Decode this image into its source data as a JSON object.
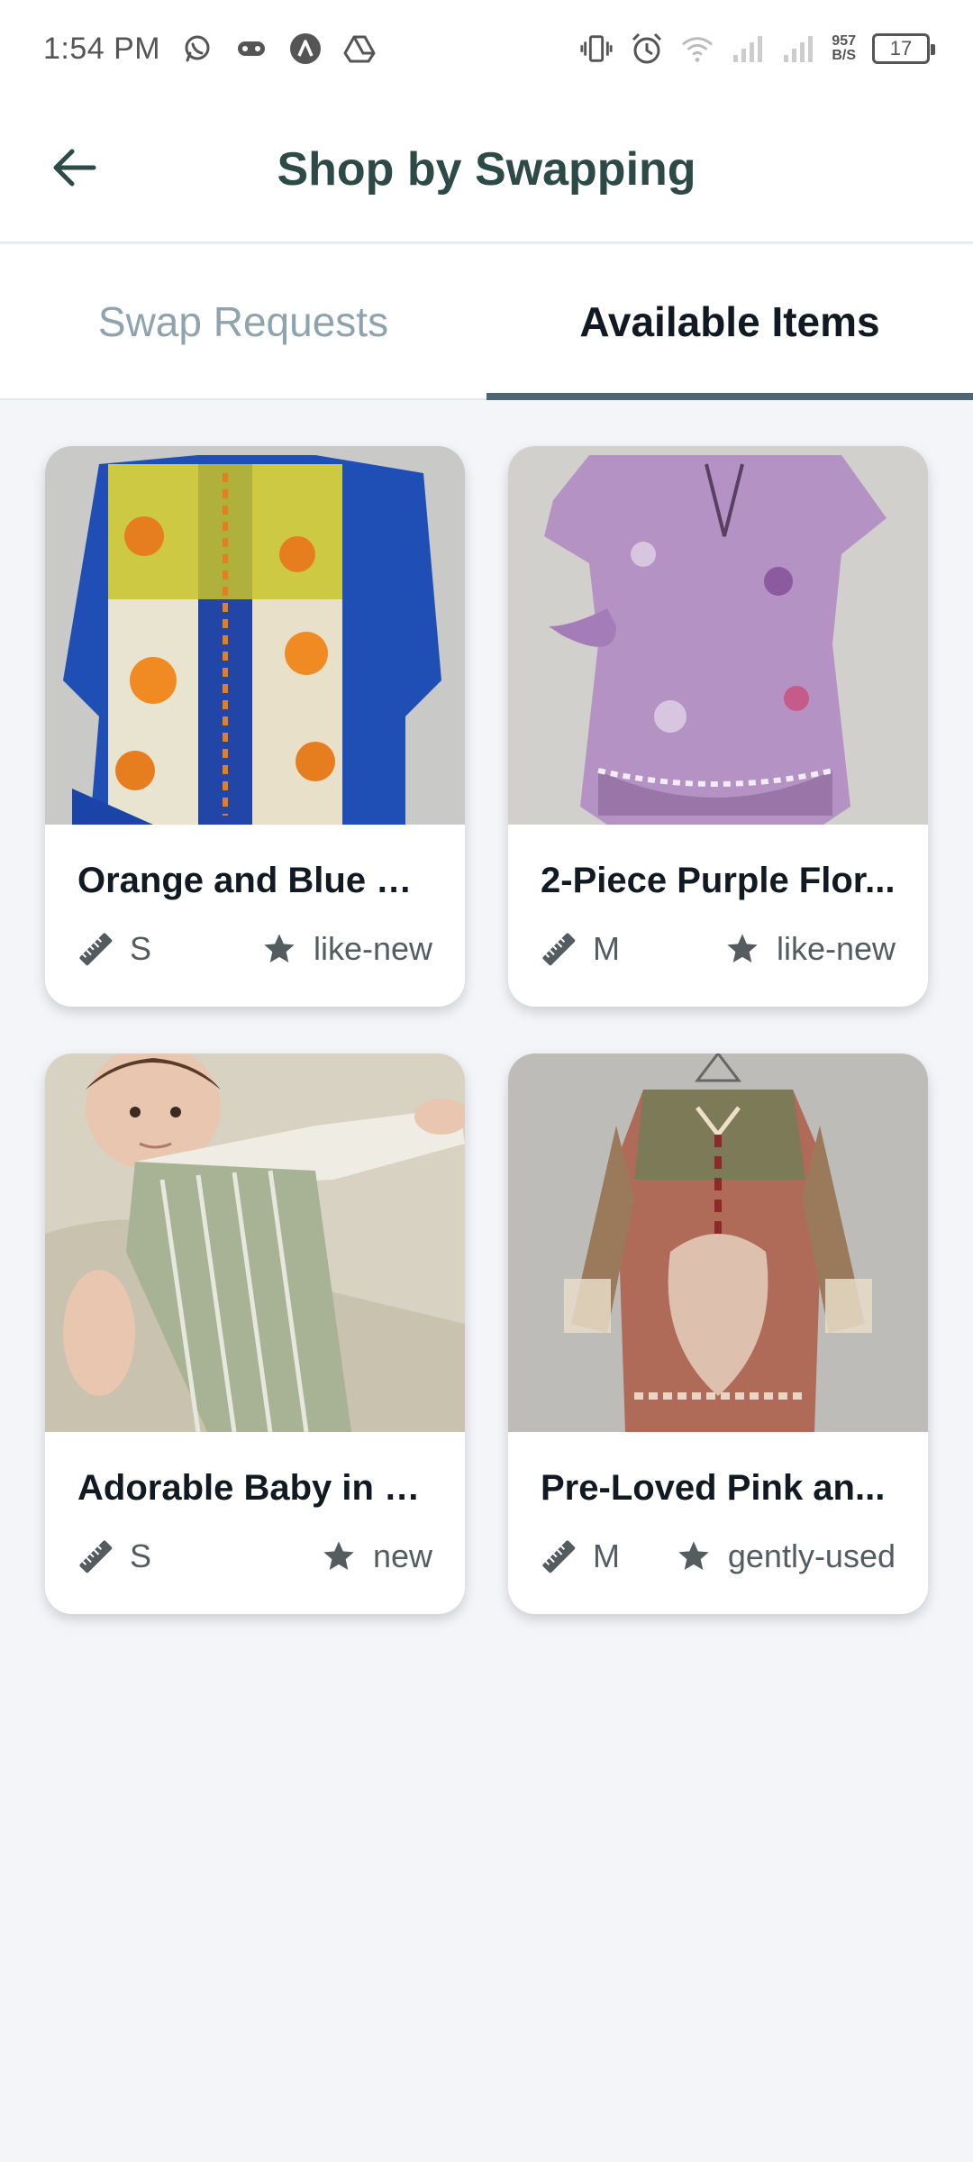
{
  "status_bar": {
    "time": "1:54 PM",
    "icons": [
      "whatsapp-icon",
      "gamepad-icon",
      "app-a-icon",
      "drive-icon"
    ],
    "right_icons": [
      "vibrate-icon",
      "alarm-icon",
      "wifi-icon",
      "signal-icon",
      "signal-icon-2"
    ],
    "net_speed_value": "957",
    "net_speed_unit": "B/S",
    "battery": "17"
  },
  "app_bar": {
    "title": "Shop by Swapping",
    "back_icon": "arrow-left-icon"
  },
  "tabs": [
    {
      "label": "Swap Requests",
      "active": false
    },
    {
      "label": "Available Items",
      "active": true
    }
  ],
  "items": [
    {
      "title": "Orange and Blue Fl...",
      "size": "S",
      "condition": "like-new",
      "image": "orange-blue-floral-dress"
    },
    {
      "title": "2-Piece Purple Flor...",
      "size": "M",
      "condition": "like-new",
      "image": "purple-floral-kurta"
    },
    {
      "title": "Adorable Baby in G...",
      "size": "S",
      "condition": "new",
      "image": "baby-green-overalls"
    },
    {
      "title": "Pre-Loved Pink an...",
      "size": "M",
      "condition": "gently-used",
      "image": "pink-green-embroidered-kurta"
    }
  ],
  "colors": {
    "title": "#2d4a46",
    "tab_indicator": "#4e6672",
    "background": "#f3f5f9"
  }
}
